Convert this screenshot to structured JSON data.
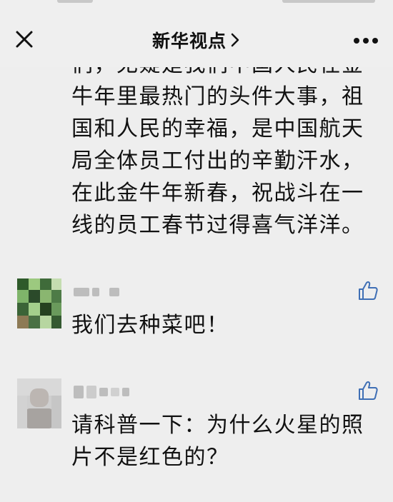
{
  "nav": {
    "title": "新华视点",
    "close_icon": "close-icon",
    "chevron_icon": "chevron-right-icon",
    "more_icon": "more-dots-icon"
  },
  "article": {
    "lines": [
      "们，无疑是我们中国人民在金",
      "牛年里最热门的头件大事，祖",
      "国和人民的幸福，是中国航天",
      "局全体员工付出的辛勤汗水，",
      "在此金牛年新春，祝战斗在一",
      "线的员工春节过得喜气洋洋。"
    ]
  },
  "comments": [
    {
      "text": "我们去种菜吧！",
      "like_icon": "thumbs-up-icon"
    },
    {
      "text_lines": [
        "请科普一下：为什么火星的照",
        "片不是红色的？"
      ],
      "like_icon": "thumbs-up-icon"
    }
  ],
  "colors": {
    "background": "#eeeeee",
    "text": "#111111",
    "like": "#3f6fb5"
  }
}
